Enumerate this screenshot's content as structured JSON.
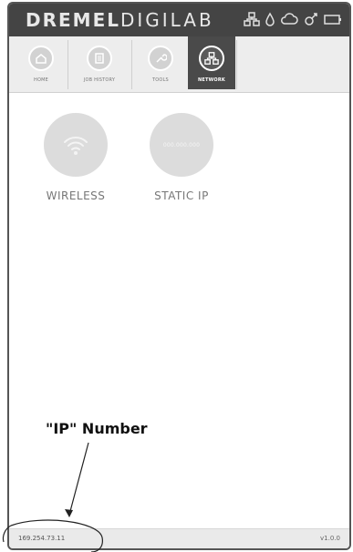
{
  "header": {
    "brand_bold": "DREMEL",
    "brand_light": "DIGILAB",
    "status_icons": [
      "network-icon",
      "filament-drop-icon",
      "cloud-icon",
      "settings-icon",
      "battery-icon"
    ]
  },
  "tabs": [
    {
      "label": "HOME",
      "icon": "home-icon",
      "active": false
    },
    {
      "label": "JOB HISTORY",
      "icon": "document-icon",
      "active": false
    },
    {
      "label": "TOOLS",
      "icon": "wrench-icon",
      "active": false
    },
    {
      "label": "NETWORK",
      "icon": "network-icon",
      "active": true
    }
  ],
  "network_options": [
    {
      "label": "WIRELESS",
      "icon": "wifi-icon"
    },
    {
      "label": "STATIC IP",
      "circle_text": "000.000.000"
    }
  ],
  "footer": {
    "ip": "169.254.73.11",
    "version": "v1.0.0"
  },
  "annotation": {
    "label": "\"IP\" Number"
  },
  "colors": {
    "header_bg": "#444444",
    "active_tab_bg": "#4a4a4a",
    "tabbar_bg": "#ededed",
    "circle_bg": "#dcdcdc"
  }
}
